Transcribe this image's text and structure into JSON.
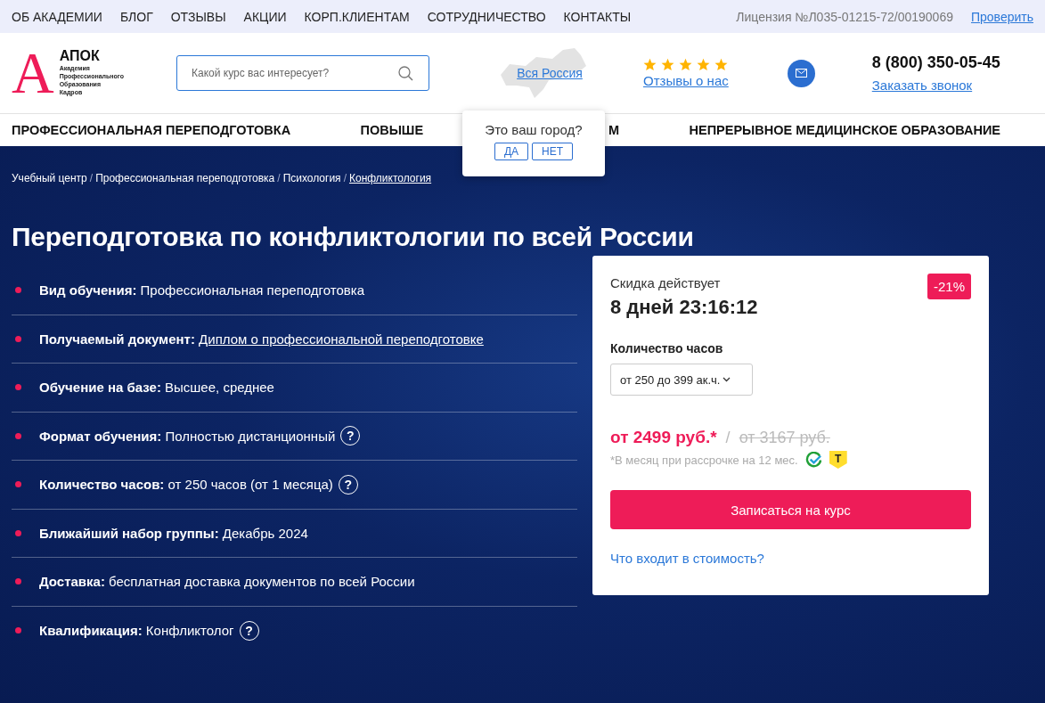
{
  "top_menu": [
    "ОБ АКАДЕМИИ",
    "БЛОГ",
    "ОТЗЫВЫ",
    "АКЦИИ",
    "КОРП.КЛИЕНТАМ",
    "СОТРУДНИЧЕСТВО",
    "КОНТАКТЫ"
  ],
  "license": {
    "text": "Лицензия №Л035-01215-72/00190069",
    "link": "Проверить"
  },
  "logo": {
    "letter": "А",
    "name": "АПОК",
    "subtitle": [
      "Академия",
      "Профессионального",
      "Образования",
      "Кадров"
    ]
  },
  "search": {
    "placeholder": "Какой курс вас интересует?"
  },
  "region": {
    "link": "Вся Россия"
  },
  "reviews": {
    "stars": 5,
    "link": "Отзывы о нас"
  },
  "phone": {
    "number": "8 (800) 350-05-45",
    "callback": "Заказать звонок"
  },
  "nav": [
    {
      "label_start": "ПРОФЕССИОНАЛЬНАЯ ПЕРЕПОДГОТОВКА"
    },
    {
      "label_start": "ПОВЫШЕ",
      "label_end": "М"
    },
    {
      "label_start": "НЕПРЕРЫВНОЕ МЕДИЦИНСКОЕ ОБРАЗОВАНИЕ"
    }
  ],
  "city_popup": {
    "question": "Это ваш город?",
    "buttons": [
      "ДА",
      "НЕТ"
    ]
  },
  "breadcrumbs": [
    {
      "label": "Учебный центр",
      "current": false
    },
    {
      "label": "Профессиональная переподготовка",
      "current": false
    },
    {
      "label": "Психология",
      "current": false
    },
    {
      "label": "Конфликтология",
      "current": true
    }
  ],
  "breadcrumb_separator": "/",
  "title": "Переподготовка по конфликтологии по всей России",
  "facts": [
    {
      "label": "Вид обучения:",
      "value": "Профессиональная переподготовка",
      "kind": "text",
      "help": false
    },
    {
      "label": "Получаемый документ:",
      "value": "Диплом о профессиональной переподготовке",
      "kind": "link",
      "help": false
    },
    {
      "label": "Обучение на базе:",
      "value": "Высшее, среднее",
      "kind": "text",
      "help": false
    },
    {
      "label": "Формат обучения:",
      "value": "Полностью дистанционный",
      "kind": "text",
      "help": true
    },
    {
      "label": "Количество часов:",
      "value": "от 250 часов (от 1 месяца)",
      "kind": "text",
      "help": true
    },
    {
      "label": "Ближайший набор группы:",
      "value": "Декабрь 2024",
      "kind": "text",
      "help": false
    },
    {
      "label": "Доставка:",
      "value": "бесплатная доставка документов по всей России",
      "kind": "text",
      "help": false
    },
    {
      "label": "Квалификация:",
      "value": "Конфликтолог",
      "kind": "text",
      "help": true
    }
  ],
  "help_mark": "?",
  "offer": {
    "discount_label": "Скидка действует",
    "countdown": "8 дней 23:16:12",
    "discount": "-21%",
    "hours_label": "Количество часов",
    "hours_value": "от 250 до 399 ак.ч.",
    "price": "от 2499 руб.*",
    "separator": "/",
    "old_price": "от 3167 руб.",
    "installment_note": "*В месяц при рассрочке на 12 мес.",
    "bank_mark": "Т",
    "enroll_button": "Записаться на курс",
    "cost_link": "Что входит в стоимость?"
  }
}
